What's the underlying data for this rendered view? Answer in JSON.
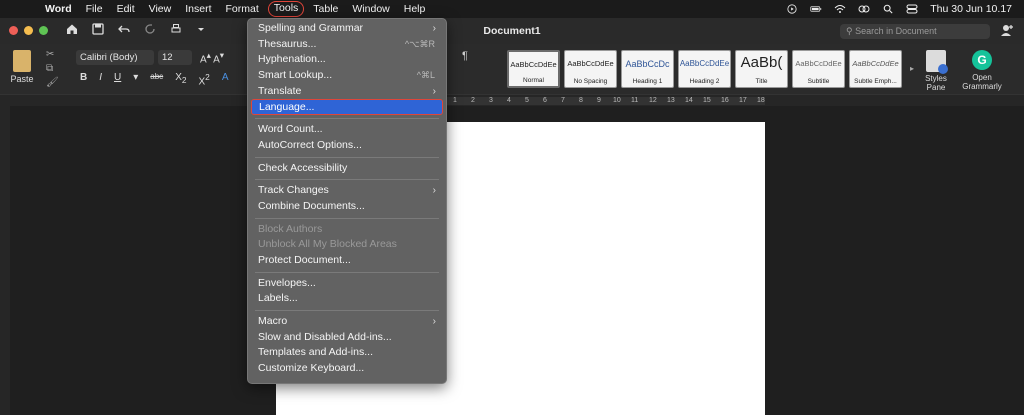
{
  "menubar": {
    "app": "Word",
    "items": [
      "File",
      "Edit",
      "View",
      "Insert",
      "Format",
      "Tools",
      "Table",
      "Window",
      "Help"
    ],
    "active_item": "Tools",
    "clock": "Thu 30 Jun  10.17"
  },
  "titlebar": {
    "document_title": "Document1",
    "search_placeholder": "Search in Document"
  },
  "ribbon": {
    "paste_label": "Paste",
    "font_name": "Calibri (Body)",
    "font_size": "12",
    "styles": [
      {
        "sample": "AaBbCcDdEe",
        "name": "Normal"
      },
      {
        "sample": "AaBbCcDdEe",
        "name": "No Spacing"
      },
      {
        "sample": "AaBbCcDc",
        "name": "Heading 1"
      },
      {
        "sample": "AaBbCcDdEe",
        "name": "Heading 2"
      },
      {
        "sample": "AaBb(",
        "name": "Title"
      },
      {
        "sample": "AaBbCcDdEe",
        "name": "Subtitle"
      },
      {
        "sample": "AaBbCcDdEe",
        "name": "Subtle Emph..."
      }
    ],
    "styles_pane_label": "Styles Pane",
    "grammarly_label": "Open Grammarly"
  },
  "ruler": {
    "numbers": [
      "1",
      "2",
      "3",
      "4",
      "5",
      "6",
      "7",
      "8",
      "9",
      "10",
      "11",
      "12",
      "13",
      "14",
      "15",
      "16",
      "17",
      "18"
    ]
  },
  "tools_menu": {
    "items": [
      {
        "label": "Spelling and Grammar",
        "submenu": true
      },
      {
        "label": "Thesaurus...",
        "shortcut": "^⌥⌘R"
      },
      {
        "label": "Hyphenation..."
      },
      {
        "label": "Smart Lookup...",
        "shortcut": "^⌘L"
      },
      {
        "label": "Translate",
        "submenu": true
      },
      {
        "label": "Language...",
        "highlighted": true
      },
      {
        "separator": true
      },
      {
        "label": "Word Count..."
      },
      {
        "label": "AutoCorrect Options..."
      },
      {
        "separator": true
      },
      {
        "label": "Check Accessibility"
      },
      {
        "separator": true
      },
      {
        "label": "Track Changes",
        "submenu": true
      },
      {
        "label": "Combine Documents..."
      },
      {
        "separator": true
      },
      {
        "label": "Block Authors",
        "disabled": true
      },
      {
        "label": "Unblock All My Blocked Areas",
        "disabled": true
      },
      {
        "label": "Protect Document..."
      },
      {
        "separator": true
      },
      {
        "label": "Envelopes..."
      },
      {
        "label": "Labels..."
      },
      {
        "separator": true
      },
      {
        "label": "Macro",
        "submenu": true
      },
      {
        "label": "Slow and Disabled Add-ins..."
      },
      {
        "label": "Templates and Add-ins..."
      },
      {
        "label": "Customize Keyboard..."
      }
    ]
  },
  "colors": {
    "highlight": "#2f64d6",
    "annotation_outline": "#e0453a",
    "menu_bg": "#626262"
  }
}
